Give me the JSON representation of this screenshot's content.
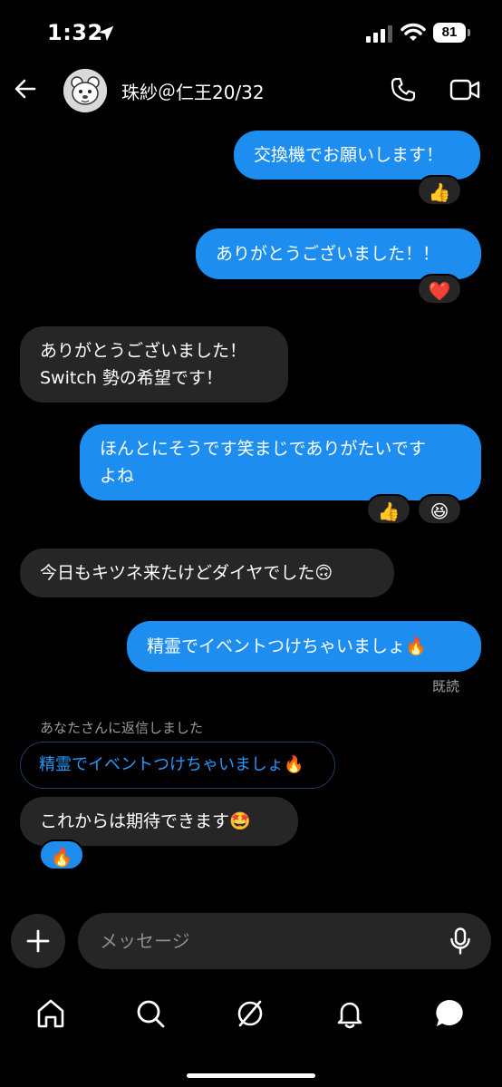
{
  "status_bar": {
    "time": "1:32",
    "battery": "81"
  },
  "header": {
    "contact_name": "珠紗＠仁王20/32"
  },
  "messages": [
    {
      "id": "m1",
      "text": "交換機でお願いします！"
    },
    {
      "id": "m2",
      "text": "ありがとうございました！！"
    },
    {
      "id": "m3",
      "line1": "ありがとうございました！",
      "line2": "Switch 勢の希望です！"
    },
    {
      "id": "m4",
      "line1": "ほんとにそうです笑まじでありがたいです",
      "line2": "よね"
    },
    {
      "id": "m5",
      "text": "今日もキツネ来たけどダイヤでした🙃"
    },
    {
      "id": "m6",
      "text": "精霊でイベントつけちゃいましょ🔥"
    },
    {
      "id": "m7",
      "text": "これからは期待できます🤩"
    }
  ],
  "reactions": {
    "r1": "👍",
    "r2": "❤️",
    "r3a": "👍",
    "r3b": "😆",
    "r4": "🔥"
  },
  "read_receipt": "既読",
  "reply": {
    "note": "あなたさんに返信しました",
    "quoted": "精霊でイベントつけちゃいましょ🔥"
  },
  "composer": {
    "placeholder": "メッセージ"
  },
  "colors": {
    "outgoing": "#1d8ef0",
    "incoming": "#262626",
    "background": "#000000",
    "link": "#2b96f5"
  },
  "tab_icons": [
    "home-icon",
    "search-icon",
    "explore-icon",
    "notifications-icon",
    "messages-icon"
  ]
}
